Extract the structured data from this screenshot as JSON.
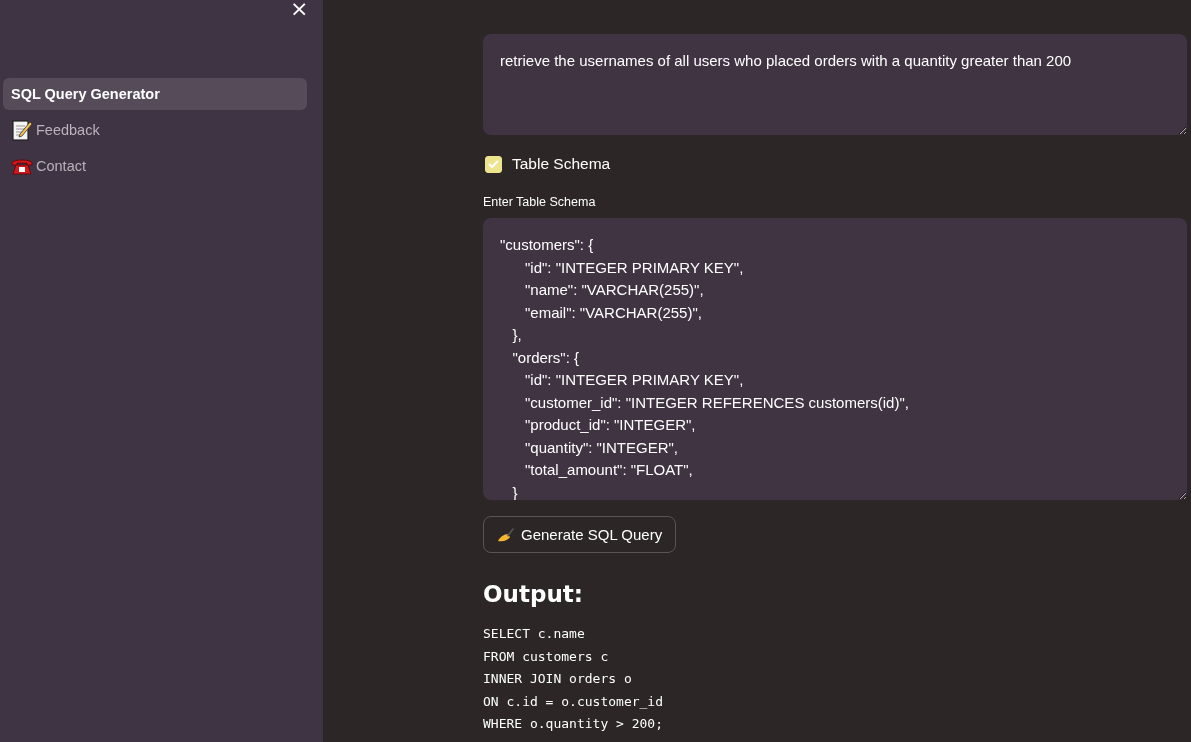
{
  "sidebar": {
    "close": "×",
    "items": [
      {
        "label": "SQL Query Generator",
        "selected": true,
        "kind": "plain"
      },
      {
        "label": "Feedback",
        "selected": false,
        "kind": "memo"
      },
      {
        "label": "Contact",
        "selected": false,
        "kind": "phone"
      }
    ]
  },
  "query": {
    "value": "retrieve the usernames of all users who placed orders with a quantity greater than 200"
  },
  "schema_toggle": {
    "label": "Table Schema",
    "checked": true
  },
  "schema": {
    "label": "Enter Table Schema",
    "lines": [
      "\"customers\": {",
      "      \"id\": \"INTEGER PRIMARY KEY\",",
      "      \"name\": \"VARCHAR(255)\",",
      "      \"email\": \"VARCHAR(255)\",",
      "   },",
      "   \"orders\": {",
      "      \"id\": \"INTEGER PRIMARY KEY\",",
      "      \"customer_id\": \"INTEGER REFERENCES customers(id)\",",
      "      \"product_id\": \"INTEGER\",",
      "      \"quantity\": \"INTEGER\",",
      "      \"total_amount\": \"FLOAT\",",
      "   }"
    ]
  },
  "generate_button": {
    "label": "Generate SQL Query"
  },
  "output": {
    "heading": "Output:",
    "lines": [
      "SELECT c.name",
      "FROM customers c",
      "INNER JOIN orders o",
      "ON c.id = o.customer_id",
      "WHERE o.quantity > 200;"
    ]
  }
}
